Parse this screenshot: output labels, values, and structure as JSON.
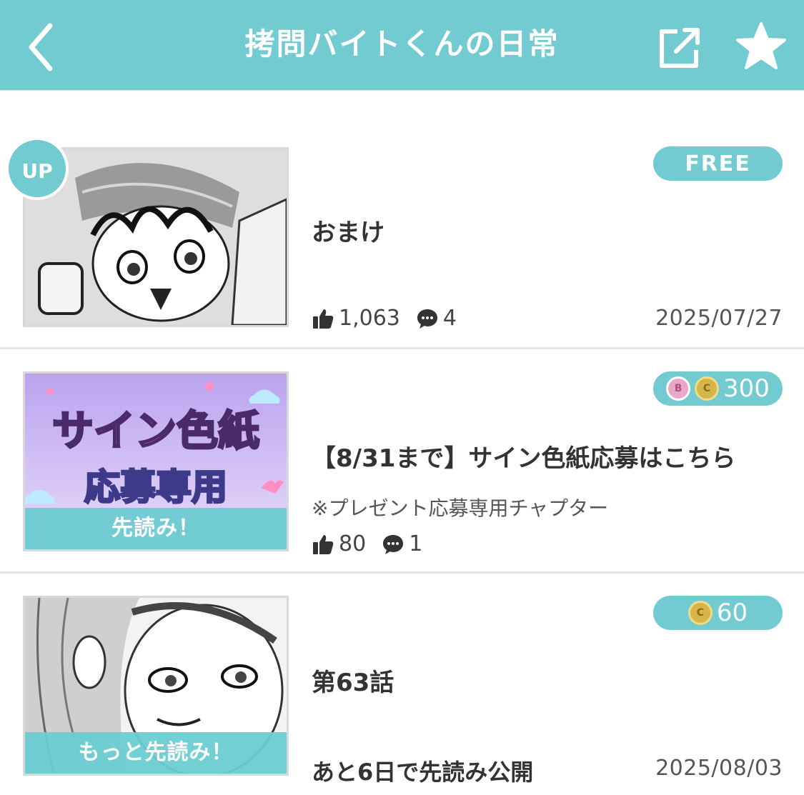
{
  "header": {
    "title": "拷問バイトくんの日常",
    "back_icon": "chevron-left-icon",
    "share_icon": "share-icon",
    "favorite_icon": "star-icon",
    "color": "#72cbd0"
  },
  "episodes": [
    {
      "badge": "UP",
      "price_label": "FREE",
      "title": "おまけ",
      "likes": "1,063",
      "comments": "4",
      "date": "2025/07/27"
    },
    {
      "price": "300",
      "coin_b": "B",
      "coin_c": "C",
      "title": "【8/31まで】サイン色紙応募はこちら",
      "subtitle": "※プレゼント応募専用チャプター",
      "thumb_text_1": "サイン色紙",
      "thumb_text_2": "応募専用",
      "ribbon": "先読み！",
      "likes": "80",
      "comments": "1"
    },
    {
      "price": "60",
      "coin_c": "C",
      "title": "第63話",
      "ribbon": "もっと先読み！",
      "release_note": "あと6日で先読み公開",
      "date": "2025/08/03"
    }
  ]
}
